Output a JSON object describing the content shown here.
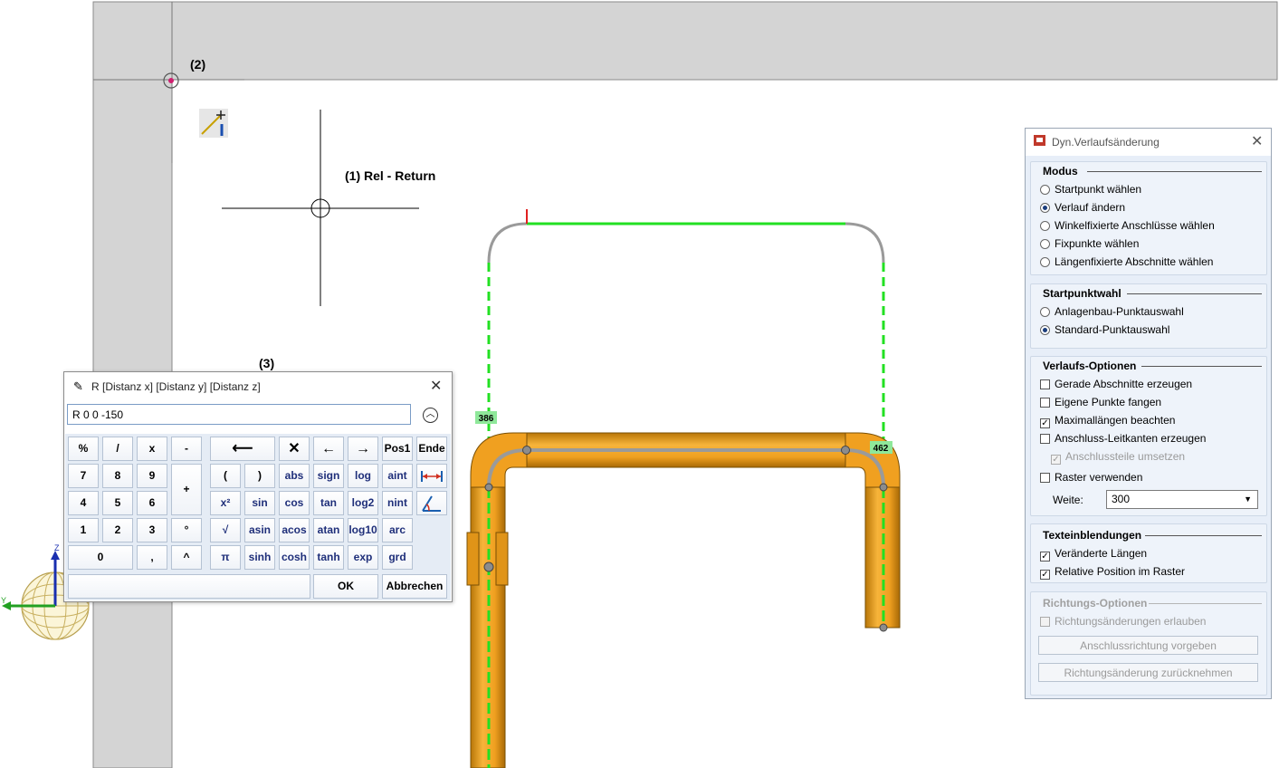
{
  "annotations": {
    "label_1": "(1) Rel - Return",
    "label_2": "(2)",
    "label_3": "(3)"
  },
  "dimension_badges": {
    "left": "386",
    "right": "462"
  },
  "calculator": {
    "title": "R [Distanz x] [Distanz y] [Distanz z]",
    "input_value": "R 0 0 -150",
    "keys": {
      "pct": "%",
      "div": "/",
      "mul": "x",
      "minus": "-",
      "backspace": "⟵",
      "clear": "✕",
      "left": "←",
      "right": "→",
      "pos1": "Pos1",
      "end": "Ende",
      "n7": "7",
      "n8": "8",
      "n9": "9",
      "plus": "+",
      "lpar": "(",
      "rpar": ")",
      "abs": "abs",
      "sign": "sign",
      "log": "log",
      "aint": "aint",
      "n4": "4",
      "n5": "5",
      "n6": "6",
      "sq": "x²",
      "sin": "sin",
      "cos": "cos",
      "tan": "tan",
      "log2": "log2",
      "nint": "nint",
      "n1": "1",
      "n2": "2",
      "n3": "3",
      "deg": "°",
      "sqrt": "√",
      "asin": "asin",
      "acos": "acos",
      "atan": "atan",
      "log10": "log10",
      "arc": "arc",
      "n0": "0",
      "comma": ",",
      "pow": "^",
      "pi": "π",
      "sinh": "sinh",
      "cosh": "cosh",
      "tanh": "tanh",
      "exp": "exp",
      "grd": "grd",
      "ok": "OK",
      "cancel": "Abbrechen"
    }
  },
  "axes": {
    "z": "Z",
    "y": "Y"
  },
  "panel": {
    "title": "Dyn.Verlaufsänderung",
    "modus": {
      "header": "Modus",
      "options": [
        "Startpunkt wählen",
        "Verlauf ändern",
        "Winkelfixierte Anschlüsse wählen",
        "Fixpunkte wählen",
        "Längenfixierte Abschnitte wählen"
      ],
      "selected": 1
    },
    "startpunktwahl": {
      "header": "Startpunktwahl",
      "options": [
        "Anlagenbau-Punktauswahl",
        "Standard-Punktauswahl"
      ],
      "selected": 1
    },
    "verlaufs_optionen": {
      "header": "Verlaufs-Optionen",
      "gerade": "Gerade Abschnitte erzeugen",
      "eigene": "Eigene Punkte fangen",
      "maximal": "Maximallängen beachten",
      "anschluss": "Anschluss-Leitkanten erzeugen",
      "umsetzen": "Anschlussteile umsetzen",
      "raster": "Raster verwenden",
      "weite_label": "Weite:",
      "weite_value": "300"
    },
    "texteinblendungen": {
      "header": "Texteinblendungen",
      "veraenderte": "Veränderte Längen",
      "relative": "Relative Position im Raster"
    },
    "richtungs_optionen": {
      "header": "Richtungs-Optionen",
      "erlauben": "Richtungsänderungen erlauben",
      "vorgeben": "Anschlussrichtung vorgeben",
      "zuruck": "Richtungsänderung zurücknehmen"
    }
  },
  "colors": {
    "pipe": "#f0a020",
    "pipe_dark": "#a36a0a",
    "green": "#22e022",
    "wall": "#d4d4d4",
    "badge": "#8fe89a"
  }
}
